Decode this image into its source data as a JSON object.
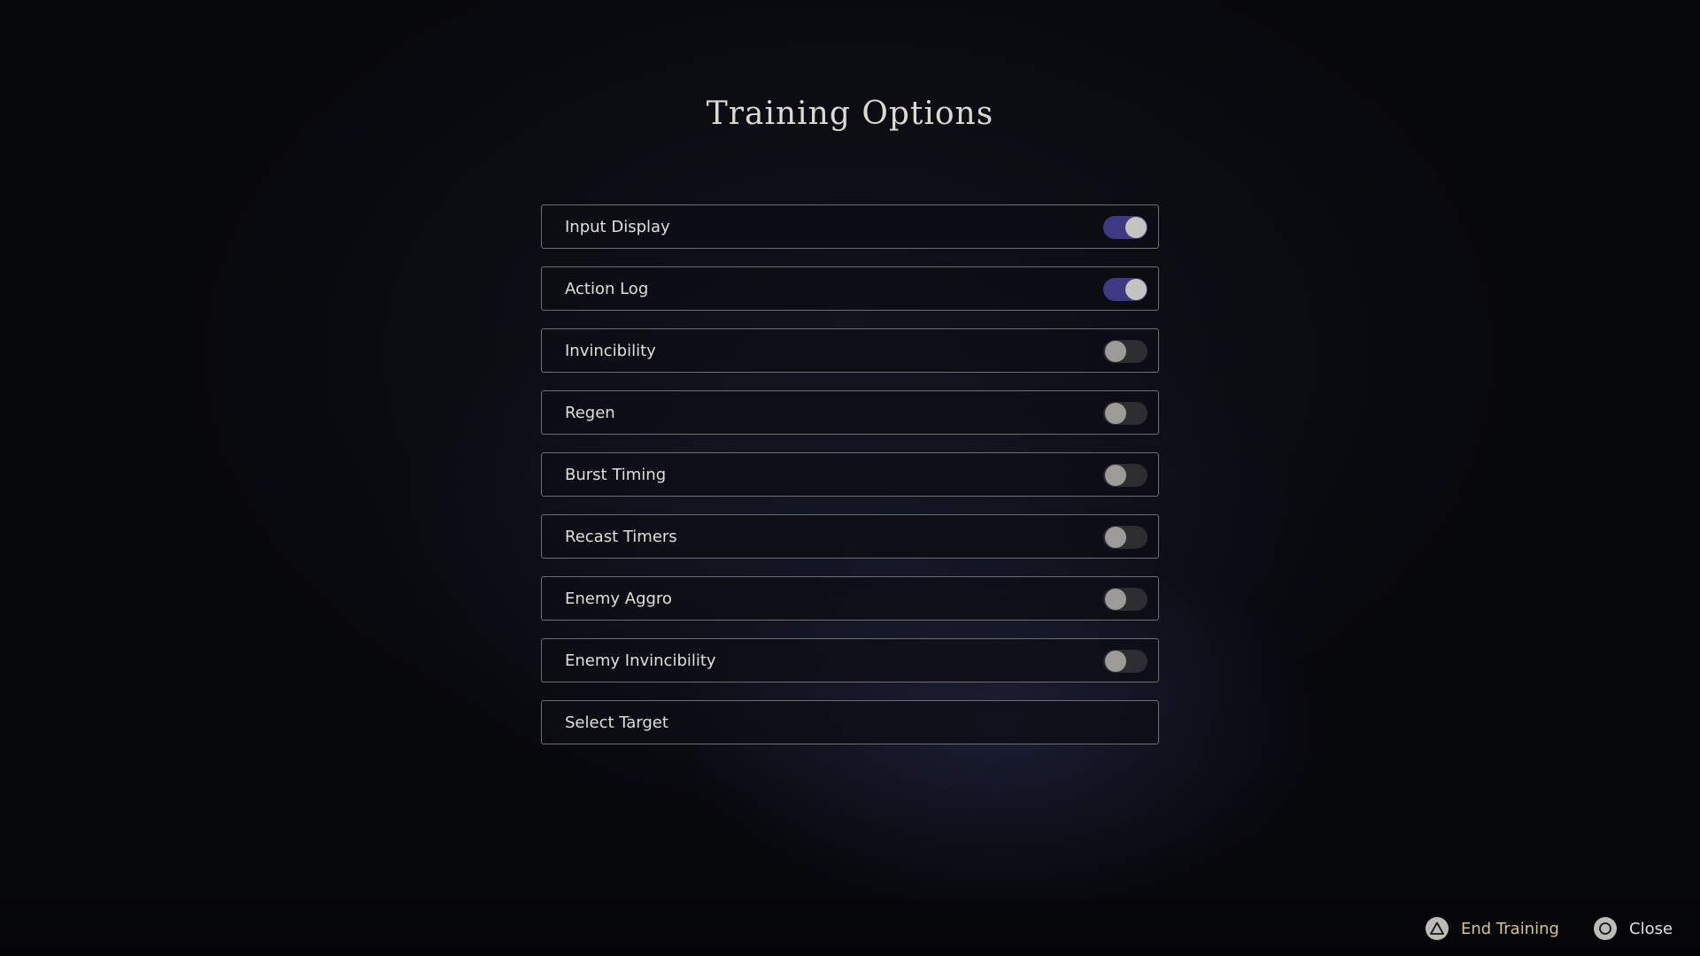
{
  "title": "Training Options",
  "options": [
    {
      "label": "Input Display",
      "toggle": true,
      "on": true
    },
    {
      "label": "Action Log",
      "toggle": true,
      "on": true
    },
    {
      "label": "Invincibility",
      "toggle": true,
      "on": false
    },
    {
      "label": "Regen",
      "toggle": true,
      "on": false
    },
    {
      "label": "Burst Timing",
      "toggle": true,
      "on": false
    },
    {
      "label": "Recast Timers",
      "toggle": true,
      "on": false
    },
    {
      "label": "Enemy Aggro",
      "toggle": true,
      "on": false
    },
    {
      "label": "Enemy Invincibility",
      "toggle": true,
      "on": false
    },
    {
      "label": "Select Target",
      "toggle": false,
      "on": false
    }
  ],
  "footer": {
    "end_training": {
      "label": "End Training",
      "icon": "triangle-button-icon"
    },
    "close": {
      "label": "Close",
      "icon": "circle-button-icon"
    }
  },
  "colors": {
    "toggle_on": "#3c3a82",
    "end_training_text": "#d6c48a"
  }
}
